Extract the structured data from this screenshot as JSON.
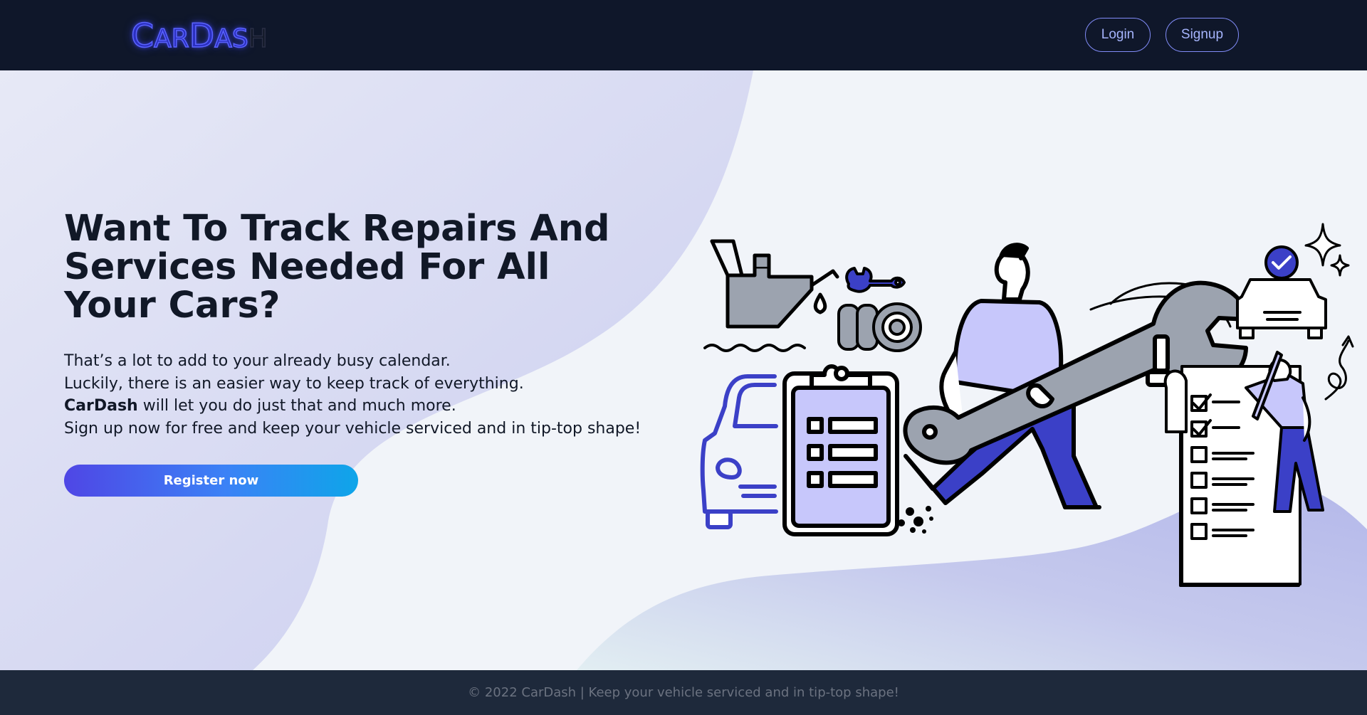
{
  "header": {
    "logo_parts": [
      "C",
      "AR",
      "D",
      "AS",
      "H"
    ],
    "login_label": "Login",
    "signup_label": "Signup"
  },
  "hero": {
    "headline": "Want To Track Repairs And Services Needed For All Your Cars?",
    "lines": [
      "That’s a lot to add to your already busy calendar.",
      "Luckily, there is an easier way to keep track of everything."
    ],
    "brand_inline": "CarDash",
    "line3_rest": " will let you do just that and much more.",
    "line4": "Sign up now for free and keep your vehicle serviced and in tip-top shape!",
    "register_label": "Register now"
  },
  "footer": {
    "text": "© 2022 CarDash | Keep your vehicle serviced and in tip-top shape!"
  },
  "colors": {
    "nav_bg": "#0f172a",
    "footer_bg": "#1e293b",
    "accent_indigo": "#4f46e5",
    "accent_sky": "#0ea5e9",
    "illustration_blue": "#3b40c7",
    "illustration_lavender": "#c7c7fb",
    "illustration_gray": "#9ca3af"
  }
}
